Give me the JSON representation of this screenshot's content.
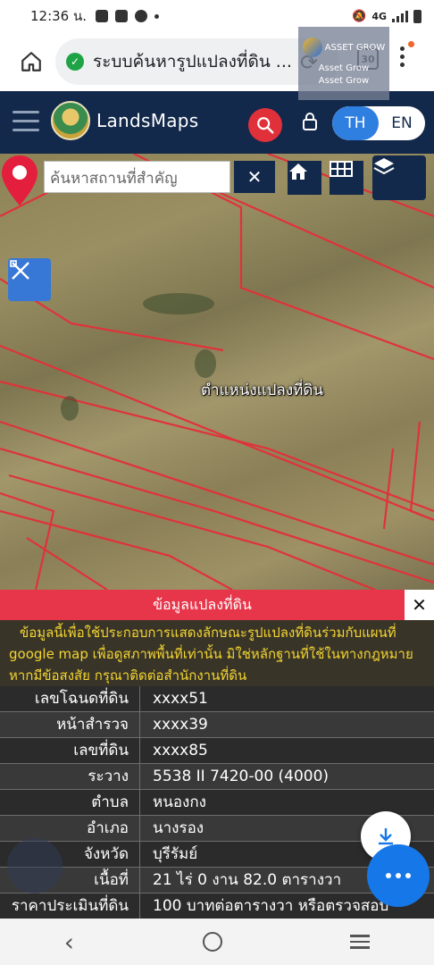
{
  "status_bar": {
    "time": "12:36 น.",
    "network_label": "4G"
  },
  "browser": {
    "url_text": "ระบบค้นหารูปแปลงที่ดิน ...",
    "tab_count": "30"
  },
  "watermark": {
    "brand": "ASSET GROW",
    "line1": "Asset Grow",
    "line2": "Asset Grow"
  },
  "header": {
    "brand": "LandsMaps",
    "lang_th": "TH",
    "lang_en": "EN"
  },
  "map": {
    "search_placeholder": "ค้นหาสถานที่สำคัญ",
    "clear_label": "✕",
    "pin_label": "ตำแหน่งแปลงที่ดิน"
  },
  "info": {
    "title": "ข้อมูลแปลงที่ดิน",
    "close_label": "✕",
    "notice_lines": [
      "ข้อมูลนี้เพื่อใช้ประกอบการแสดงลักษณะรูปแปลงที่ดินร่วมกับแผนที่",
      "google map เพื่อดูสภาพพื้นที่เท่านั้น มิใช่หลักฐานที่ใช้ในทางกฎหมาย",
      "หากมีข้อสงสัย กรุณาติดต่อสำนักงานที่ดิน"
    ],
    "rows": [
      {
        "key": "เลขโฉนดที่ดิน",
        "value": "xxxx51"
      },
      {
        "key": "หน้าสำรวจ",
        "value": "xxxx39"
      },
      {
        "key": "เลขที่ดิน",
        "value": "xxxx85"
      },
      {
        "key": "ระวาง",
        "value": "5538 II 7420-00 (4000)"
      },
      {
        "key": "ตำบล",
        "value": "หนองกง"
      },
      {
        "key": "อำเภอ",
        "value": "นางรอง"
      },
      {
        "key": "จังหวัด",
        "value": "บุรีรัมย์"
      },
      {
        "key": "เนื้อที่",
        "value": "21 ไร่ 0 งาน 82.0 ตารางวา"
      },
      {
        "key": "ราคาประเมินที่ดิน",
        "value": "100 บาทต่อตารางวา หรือตรวจสอบ"
      }
    ]
  },
  "colors": {
    "header_bg": "#13294b",
    "accent_red": "#e7354a",
    "fab_blue": "#1677e8",
    "notice_yellow": "#f3d531"
  }
}
